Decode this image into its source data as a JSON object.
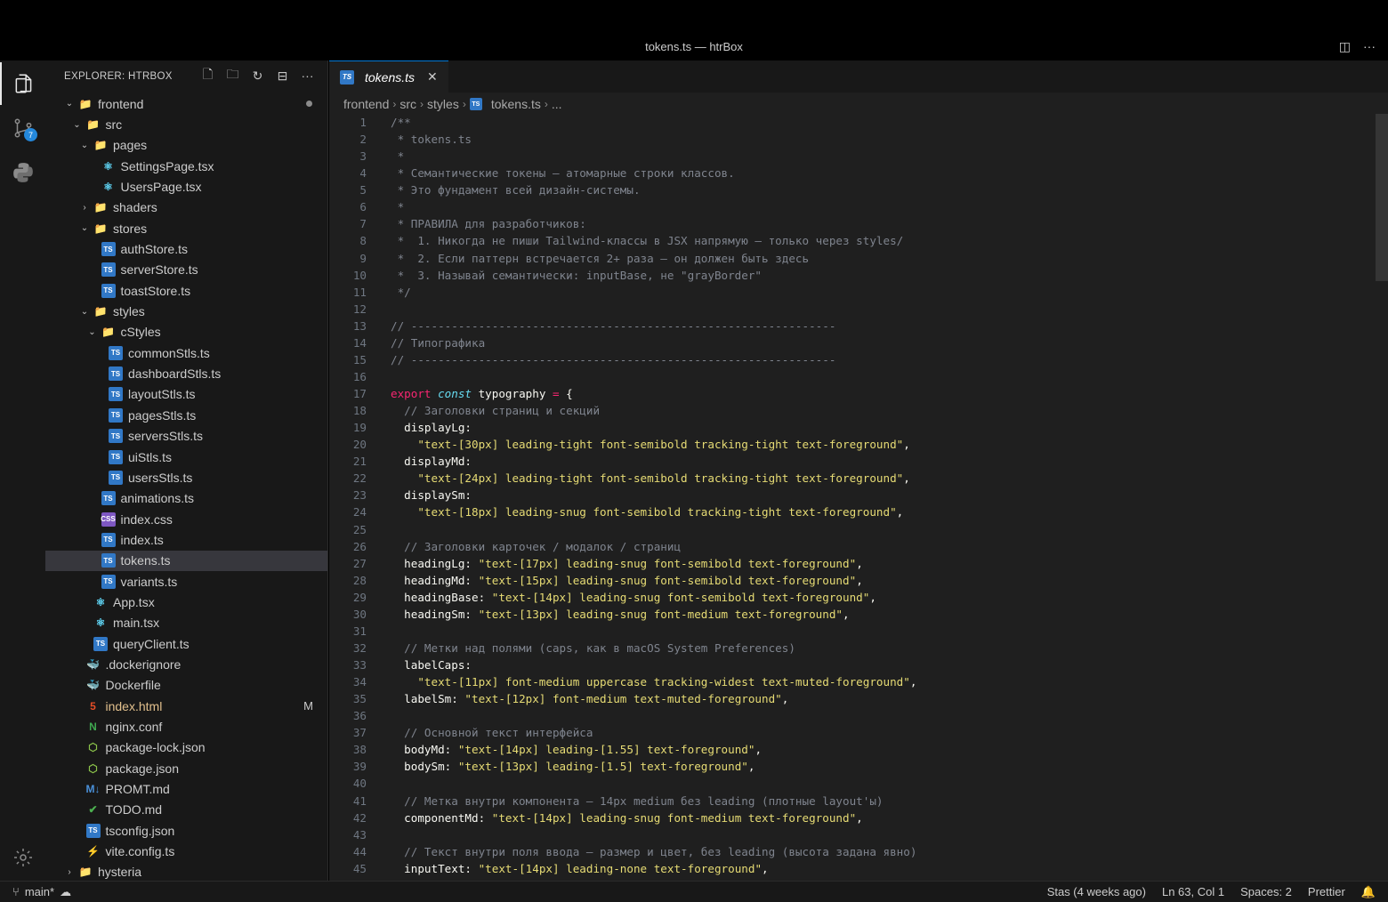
{
  "window": {
    "title": "tokens.ts — htrBox"
  },
  "sidebar": {
    "header": "EXPLORER: HTRBOX",
    "tree": [
      {
        "label": "frontend",
        "depth": 0,
        "chev": "v",
        "icon": "folder",
        "dot": true
      },
      {
        "label": "src",
        "depth": 1,
        "chev": "v",
        "icon": "folder"
      },
      {
        "label": "pages",
        "depth": 2,
        "chev": "v",
        "icon": "folder"
      },
      {
        "label": "SettingsPage.tsx",
        "depth": 3,
        "icon": "react"
      },
      {
        "label": "UsersPage.tsx",
        "depth": 3,
        "icon": "react"
      },
      {
        "label": "shaders",
        "depth": 2,
        "chev": ">",
        "icon": "folder"
      },
      {
        "label": "stores",
        "depth": 2,
        "chev": "v",
        "icon": "folder"
      },
      {
        "label": "authStore.ts",
        "depth": 3,
        "icon": "ts"
      },
      {
        "label": "serverStore.ts",
        "depth": 3,
        "icon": "ts"
      },
      {
        "label": "toastStore.ts",
        "depth": 3,
        "icon": "ts"
      },
      {
        "label": "styles",
        "depth": 2,
        "chev": "v",
        "icon": "folder"
      },
      {
        "label": "cStyles",
        "depth": 3,
        "chev": "v",
        "icon": "folder"
      },
      {
        "label": "commonStls.ts",
        "depth": 4,
        "icon": "ts"
      },
      {
        "label": "dashboardStls.ts",
        "depth": 4,
        "icon": "ts"
      },
      {
        "label": "layoutStls.ts",
        "depth": 4,
        "icon": "ts"
      },
      {
        "label": "pagesStls.ts",
        "depth": 4,
        "icon": "ts"
      },
      {
        "label": "serversStls.ts",
        "depth": 4,
        "icon": "ts"
      },
      {
        "label": "uiStls.ts",
        "depth": 4,
        "icon": "ts"
      },
      {
        "label": "usersStls.ts",
        "depth": 4,
        "icon": "ts"
      },
      {
        "label": "animations.ts",
        "depth": 3,
        "icon": "ts"
      },
      {
        "label": "index.css",
        "depth": 3,
        "icon": "css"
      },
      {
        "label": "index.ts",
        "depth": 3,
        "icon": "ts"
      },
      {
        "label": "tokens.ts",
        "depth": 3,
        "icon": "ts",
        "selected": true
      },
      {
        "label": "variants.ts",
        "depth": 3,
        "icon": "ts"
      },
      {
        "label": "App.tsx",
        "depth": 2,
        "icon": "react"
      },
      {
        "label": "main.tsx",
        "depth": 2,
        "icon": "react"
      },
      {
        "label": "queryClient.ts",
        "depth": 2,
        "icon": "ts"
      },
      {
        "label": ".dockerignore",
        "depth": 1,
        "icon": "docker"
      },
      {
        "label": "Dockerfile",
        "depth": 1,
        "icon": "docker"
      },
      {
        "label": "index.html",
        "depth": 1,
        "icon": "html",
        "mod": "M"
      },
      {
        "label": "nginx.conf",
        "depth": 1,
        "icon": "nginx"
      },
      {
        "label": "package-lock.json",
        "depth": 1,
        "icon": "npm"
      },
      {
        "label": "package.json",
        "depth": 1,
        "icon": "npm"
      },
      {
        "label": "PROMT.md",
        "depth": 1,
        "icon": "md"
      },
      {
        "label": "TODO.md",
        "depth": 1,
        "icon": "check"
      },
      {
        "label": "tsconfig.json",
        "depth": 1,
        "icon": "tsconfig"
      },
      {
        "label": "vite.config.ts",
        "depth": 1,
        "icon": "vite"
      },
      {
        "label": "hysteria",
        "depth": 0,
        "chev": ">",
        "icon": "folder"
      }
    ]
  },
  "activity": {
    "scm_badge": "7"
  },
  "tab": {
    "label": "tokens.ts",
    "icon": "TS"
  },
  "breadcrumb": [
    "frontend",
    "src",
    "styles",
    "tokens.ts",
    "..."
  ],
  "code": [
    [
      [
        "c-com",
        "/**"
      ]
    ],
    [
      [
        "c-com",
        " * tokens.ts"
      ]
    ],
    [
      [
        "c-com",
        " *"
      ]
    ],
    [
      [
        "c-com",
        " * Семантические токены — атомарные строки классов."
      ]
    ],
    [
      [
        "c-com",
        " * Это фундамент всей дизайн-системы."
      ]
    ],
    [
      [
        "c-com",
        " *"
      ]
    ],
    [
      [
        "c-com",
        " * ПРАВИЛА для разработчиков:"
      ]
    ],
    [
      [
        "c-com",
        " *  1. Никогда не пиши Tailwind-классы в JSX напрямую — только через styles/"
      ]
    ],
    [
      [
        "c-com",
        " *  2. Если паттерн встречается 2+ раза — он должен быть здесь"
      ]
    ],
    [
      [
        "c-com",
        " *  3. Называй семантически: inputBase, не \"grayBorder\""
      ]
    ],
    [
      [
        "c-com",
        " */"
      ]
    ],
    [
      [
        "",
        ""
      ]
    ],
    [
      [
        "c-com",
        "// ---------------------------------------------------------------"
      ]
    ],
    [
      [
        "c-com",
        "// Типографика"
      ]
    ],
    [
      [
        "c-com",
        "// ---------------------------------------------------------------"
      ]
    ],
    [
      [
        "",
        ""
      ]
    ],
    [
      [
        "c-kw",
        "export "
      ],
      [
        "c-kw2",
        "const "
      ],
      [
        "c-prop",
        "typography "
      ],
      [
        "c-op",
        "= "
      ],
      [
        "c-prop",
        "{"
      ]
    ],
    [
      [
        "c-com",
        "  // Заголовки страниц и секций"
      ]
    ],
    [
      [
        "c-prop",
        "  displayLg:"
      ]
    ],
    [
      [
        "c-str",
        "    \"text-[30px] leading-tight font-semibold tracking-tight text-foreground\""
      ],
      [
        "c-prop",
        ","
      ]
    ],
    [
      [
        "c-prop",
        "  displayMd:"
      ]
    ],
    [
      [
        "c-str",
        "    \"text-[24px] leading-tight font-semibold tracking-tight text-foreground\""
      ],
      [
        "c-prop",
        ","
      ]
    ],
    [
      [
        "c-prop",
        "  displaySm:"
      ]
    ],
    [
      [
        "c-str",
        "    \"text-[18px] leading-snug font-semibold tracking-tight text-foreground\""
      ],
      [
        "c-prop",
        ","
      ]
    ],
    [
      [
        "",
        ""
      ]
    ],
    [
      [
        "c-com",
        "  // Заголовки карточек / модалок / страниц"
      ]
    ],
    [
      [
        "c-prop",
        "  headingLg: "
      ],
      [
        "c-str",
        "\"text-[17px] leading-snug font-semibold text-foreground\""
      ],
      [
        "c-prop",
        ","
      ]
    ],
    [
      [
        "c-prop",
        "  headingMd: "
      ],
      [
        "c-str",
        "\"text-[15px] leading-snug font-semibold text-foreground\""
      ],
      [
        "c-prop",
        ","
      ]
    ],
    [
      [
        "c-prop",
        "  headingBase: "
      ],
      [
        "c-str",
        "\"text-[14px] leading-snug font-semibold text-foreground\""
      ],
      [
        "c-prop",
        ","
      ]
    ],
    [
      [
        "c-prop",
        "  headingSm: "
      ],
      [
        "c-str",
        "\"text-[13px] leading-snug font-medium text-foreground\""
      ],
      [
        "c-prop",
        ","
      ]
    ],
    [
      [
        "",
        ""
      ]
    ],
    [
      [
        "c-com",
        "  // Метки над полями (caps, как в macOS System Preferences)"
      ]
    ],
    [
      [
        "c-prop",
        "  labelCaps:"
      ]
    ],
    [
      [
        "c-str",
        "    \"text-[11px] font-medium uppercase tracking-widest text-muted-foreground\""
      ],
      [
        "c-prop",
        ","
      ]
    ],
    [
      [
        "c-prop",
        "  labelSm: "
      ],
      [
        "c-str",
        "\"text-[12px] font-medium text-muted-foreground\""
      ],
      [
        "c-prop",
        ","
      ]
    ],
    [
      [
        "",
        ""
      ]
    ],
    [
      [
        "c-com",
        "  // Основной текст интерфейса"
      ]
    ],
    [
      [
        "c-prop",
        "  bodyMd: "
      ],
      [
        "c-str",
        "\"text-[14px] leading-[1.55] text-foreground\""
      ],
      [
        "c-prop",
        ","
      ]
    ],
    [
      [
        "c-prop",
        "  bodySm: "
      ],
      [
        "c-str",
        "\"text-[13px] leading-[1.5] text-foreground\""
      ],
      [
        "c-prop",
        ","
      ]
    ],
    [
      [
        "",
        ""
      ]
    ],
    [
      [
        "c-com",
        "  // Метка внутри компонента — 14px medium без leading (плотные layout'ы)"
      ]
    ],
    [
      [
        "c-prop",
        "  componentMd: "
      ],
      [
        "c-str",
        "\"text-[14px] leading-snug font-medium text-foreground\""
      ],
      [
        "c-prop",
        ","
      ]
    ],
    [
      [
        "",
        ""
      ]
    ],
    [
      [
        "c-com",
        "  // Текст внутри поля ввода — размер и цвет, без leading (высота задана явно)"
      ]
    ],
    [
      [
        "c-prop",
        "  inputText: "
      ],
      [
        "c-str",
        "\"text-[14px] leading-none text-foreground\""
      ],
      [
        "c-prop",
        ","
      ]
    ]
  ],
  "status": {
    "branch": "main*",
    "blame": "Stas (4 weeks ago)",
    "position": "Ln 63, Col 1",
    "spaces": "Spaces: 2",
    "formatter": "Prettier"
  }
}
